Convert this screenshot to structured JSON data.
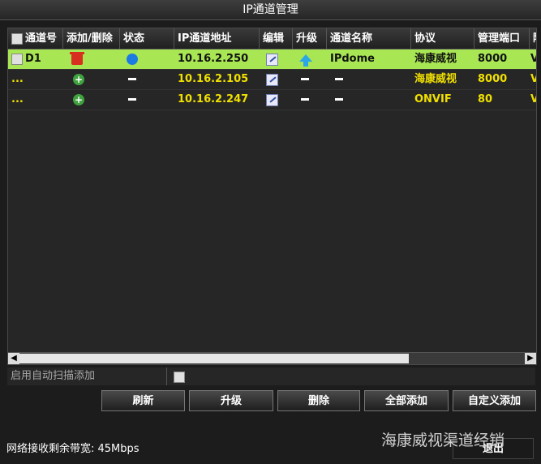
{
  "window": {
    "title": "IP通道管理"
  },
  "table": {
    "columns": [
      "通道号",
      "添加/删除",
      "状态",
      "IP通道地址",
      "编辑",
      "升级",
      "通道名称",
      "协议",
      "管理端口",
      "阿"
    ],
    "rows": [
      {
        "channel": "D1",
        "action_icon": "trash-icon",
        "status_icon": "online-dot-icon",
        "ip": "10.16.2.250",
        "edit_icon": "edit-icon",
        "upgrade_icon": "upgrade-arrow-icon",
        "name": "IPdome",
        "protocol": "海康威视",
        "port": "8000",
        "extra": "V",
        "selected": true
      },
      {
        "channel": "...",
        "action_icon": "add-icon",
        "status_icon": "dash",
        "ip": "10.16.2.105",
        "edit_icon": "edit-icon",
        "upgrade_icon": "dash",
        "name": "",
        "protocol": "海康威视",
        "port": "8000",
        "extra": "V",
        "selected": false
      },
      {
        "channel": "...",
        "action_icon": "add-icon",
        "status_icon": "dash",
        "ip": "10.16.2.247",
        "edit_icon": "edit-icon",
        "upgrade_icon": "dash",
        "name": "",
        "protocol": "ONVIF",
        "port": "80",
        "extra": "V",
        "selected": false
      }
    ]
  },
  "auto_scan": {
    "label": "启用自动扫描添加"
  },
  "buttons": {
    "refresh": "刷新",
    "upgrade": "升级",
    "delete": "删除",
    "add_all": "全部添加",
    "custom_add": "自定义添加",
    "exit": "退出"
  },
  "footer": {
    "bandwidth": "网络接收剩余带宽: 45Mbps"
  },
  "watermark": "海康威视渠道经销",
  "colors": {
    "selected_row": "#a8e653",
    "value_text": "#f0e000"
  }
}
